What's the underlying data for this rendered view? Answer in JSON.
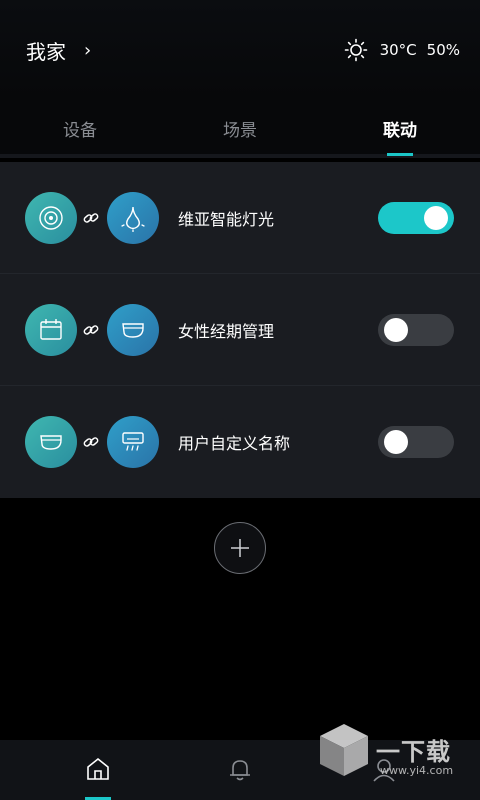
{
  "header": {
    "title": "我家",
    "chevron": "›",
    "weather": {
      "icon": "sun-icon",
      "temperature": "30°C",
      "humidity": "50%"
    }
  },
  "tabs": [
    {
      "label": "设备",
      "active": false
    },
    {
      "label": "场景",
      "active": false
    },
    {
      "label": "联动",
      "active": true
    }
  ],
  "linkages": [
    {
      "label": "维亚智能灯光",
      "enabled": true,
      "icons": [
        "sensor-icon",
        "light-bulb-icon"
      ]
    },
    {
      "label": "女性经期管理",
      "enabled": false,
      "icons": [
        "calendar-icon",
        "toilet-icon"
      ]
    },
    {
      "label": "用户自定义名称",
      "enabled": false,
      "icons": [
        "toilet-icon",
        "air-conditioner-icon"
      ]
    }
  ],
  "add_button": {
    "icon": "plus-icon"
  },
  "bottom_nav": [
    {
      "icon": "home-icon",
      "active": true
    },
    {
      "icon": "bell-icon",
      "active": false
    },
    {
      "icon": "user-icon",
      "active": false
    }
  ],
  "watermark": {
    "text": "一下载",
    "url": "www.yi4.com"
  },
  "colors": {
    "accent": "#1cc7c9",
    "background": "#000000",
    "card": "#1a1c21"
  }
}
